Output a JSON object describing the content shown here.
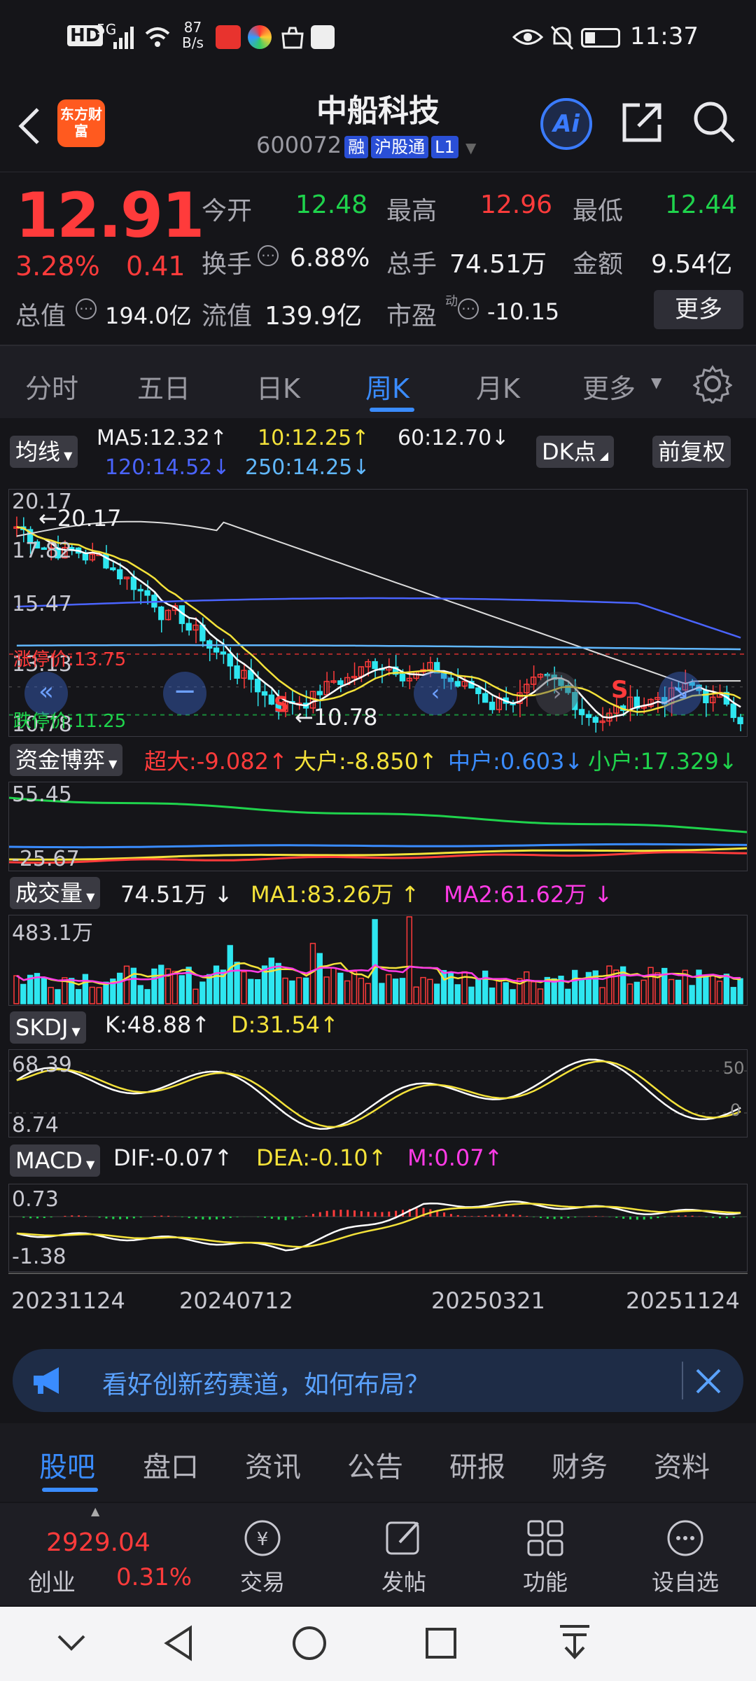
{
  "status": {
    "hd": "HD",
    "net": "5G",
    "speed_val": "87",
    "speed_unit": "B/s",
    "time": "11:37"
  },
  "header": {
    "logo": "东方财富",
    "title": "中船科技",
    "code": "600072",
    "tag_rong": "融",
    "tag_hgt": "沪股通",
    "tag_l1": "L1"
  },
  "quote": {
    "price": "12.91",
    "pct": "3.28%",
    "change": "0.41",
    "open_label": "今开",
    "open": "12.48",
    "high_label": "最高",
    "high": "12.96",
    "low_label": "最低",
    "low": "12.44",
    "turnover_label": "换手",
    "turnover": "6.88%",
    "volume_label": "总手",
    "volume": "74.51万",
    "amount_label": "金额",
    "amount": "9.54亿",
    "mktcap_label": "总值",
    "mktcap": "194.0亿",
    "float_label": "流值",
    "float": "139.9亿",
    "pe_label": "市盈",
    "pe_sup": "动",
    "pe": "-10.15",
    "more": "更多"
  },
  "tabs": [
    "分时",
    "五日",
    "日K",
    "周K",
    "月K",
    "更多"
  ],
  "ma": {
    "selector": "均线",
    "ma5": "MA5:12.32",
    "ma10": "10:12.25",
    "ma60": "60:12.70",
    "ma120": "120:14.52",
    "ma250": "250:14.25",
    "dk": "DK点",
    "fq": "前复权"
  },
  "kline": {
    "y_top": "20.17",
    "y_mid1": "17.82",
    "y_mid2": "15.47",
    "y_mid3": "13.13",
    "y_bot": "10.78",
    "max_note": "←20.17",
    "min_note": "←10.78",
    "limit_up": "涨停价:13.75",
    "limit_down": "跌停价:11.25",
    "sig_s": "S"
  },
  "fund": {
    "selector": "资金博弈",
    "super": "超大:-9.082",
    "large": "大户:-8.850",
    "mid": "中户:0.603",
    "small": "小户:17.329",
    "y_top": "55.45",
    "y_bot": "-25.67"
  },
  "vol": {
    "selector": "成交量",
    "cur": "74.51万",
    "ma1": "MA1:83.26万",
    "ma2": "MA2:61.62万",
    "y_top": "483.1万"
  },
  "skdj": {
    "selector": "SKDJ",
    "k": "K:48.88",
    "d": "D:31.54",
    "y_top": "68.39",
    "y_bot": "8.74",
    "r_top": "50",
    "r_bot": "0"
  },
  "macd": {
    "selector": "MACD",
    "dif": "DIF:-0.07",
    "dea": "DEA:-0.10",
    "m": "M:0.07",
    "y_top": "0.73",
    "y_bot": "-1.38"
  },
  "dates": [
    "20231124",
    "20240712",
    "20250321",
    "20251124"
  ],
  "banner": {
    "text": "看好创新药赛道，如何布局？"
  },
  "btabs": [
    "股吧",
    "盘口",
    "资讯",
    "公告",
    "研报",
    "财务",
    "资料"
  ],
  "toolbar": {
    "index_val": "2929.04",
    "index_name": "创业",
    "index_pct": "0.31%",
    "trade": "交易",
    "post": "发帖",
    "func": "功能",
    "fav": "设自选"
  }
}
